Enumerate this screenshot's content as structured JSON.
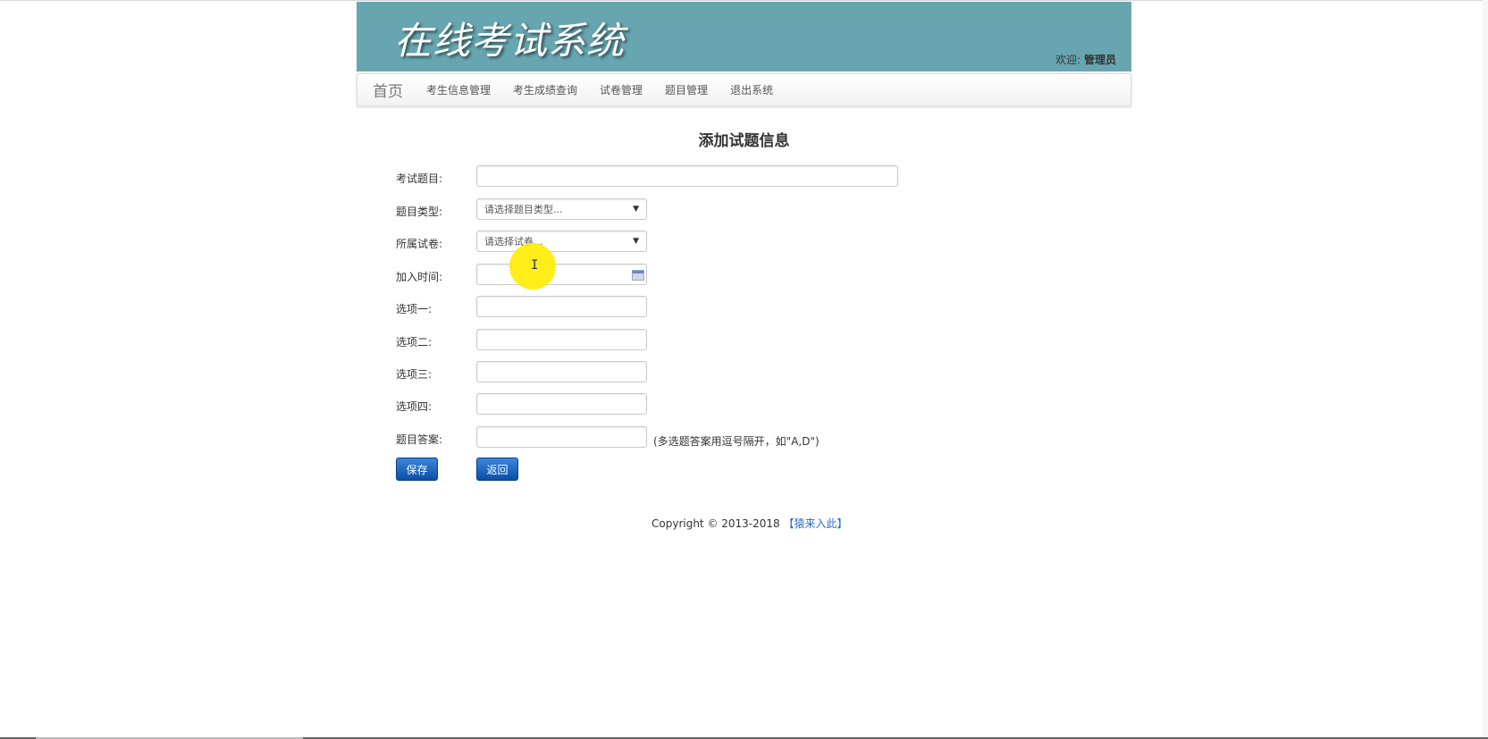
{
  "header": {
    "logo_text": "在线考试系统",
    "welcome_prefix": "欢迎:",
    "user_name": "管理员"
  },
  "nav": {
    "brand": "首页",
    "items": [
      {
        "label": "考生信息管理"
      },
      {
        "label": "考生成绩查询"
      },
      {
        "label": "试卷管理"
      },
      {
        "label": "题目管理"
      },
      {
        "label": "退出系统"
      }
    ]
  },
  "page": {
    "title": "添加试题信息"
  },
  "form": {
    "question": {
      "label": "考试题目:",
      "value": ""
    },
    "type": {
      "label": "题目类型:",
      "selected": "请选择题目类型..."
    },
    "paper": {
      "label": "所属试卷:",
      "selected": "请选择试卷..."
    },
    "join_time": {
      "label": "加入时间:",
      "value": ""
    },
    "option1": {
      "label": "选项一:",
      "value": ""
    },
    "option2": {
      "label": "选项二:",
      "value": ""
    },
    "option3": {
      "label": "选项三:",
      "value": ""
    },
    "option4": {
      "label": "选项四:",
      "value": ""
    },
    "answer": {
      "label": "题目答案:",
      "value": "",
      "hint": "(多选题答案用逗号隔开，如\"A,D\")"
    }
  },
  "buttons": {
    "save": "保存",
    "back": "返回"
  },
  "footer": {
    "copyright": "Copyright © 2013-2018 ",
    "link": "【猿来入此】"
  },
  "colors": {
    "header_bg": "#67a6b0",
    "button_bg": "#0b4fa8",
    "link": "#2a6fc2",
    "cursor_highlight": "#ffec00"
  },
  "icons": {
    "select_arrow": "▼",
    "date_picker": "calendar-icon",
    "cursor": "I"
  }
}
